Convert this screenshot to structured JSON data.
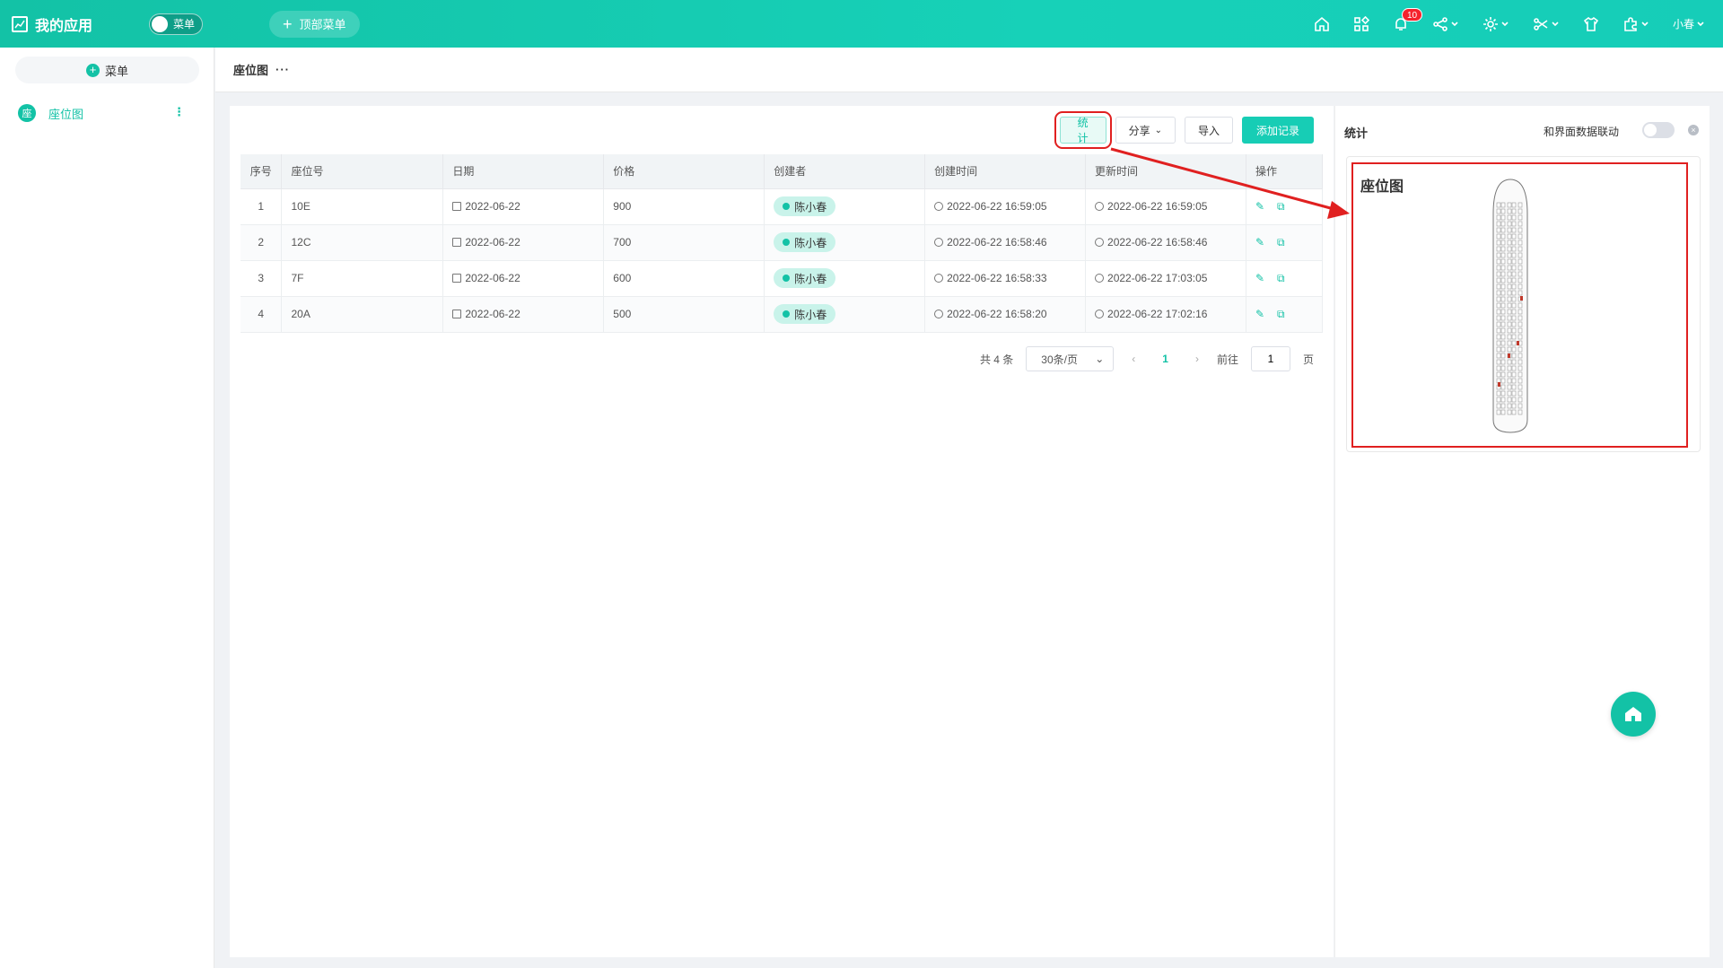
{
  "app": {
    "title": "我的应用"
  },
  "topbar": {
    "menu_toggle_label": "菜单",
    "top_menu_label": "顶部菜单",
    "notification_count": "10",
    "user_name": "小春"
  },
  "sidebar": {
    "add_menu_label": "菜单",
    "items": [
      {
        "icon_text": "座",
        "label": "座位图"
      }
    ]
  },
  "page": {
    "title": "座位图"
  },
  "toolbar": {
    "stat_label": "统计",
    "share_label": "分享",
    "import_label": "导入",
    "add_label": "添加记录"
  },
  "table": {
    "columns": [
      "序号",
      "座位号",
      "日期",
      "价格",
      "创建者",
      "创建时间",
      "更新时间",
      "操作"
    ],
    "rows": [
      {
        "seq": "1",
        "seat": "10E",
        "date": "2022-06-22",
        "price": "900",
        "creator": "陈小春",
        "created": "2022-06-22 16:59:05",
        "updated": "2022-06-22 16:59:05"
      },
      {
        "seq": "2",
        "seat": "12C",
        "date": "2022-06-22",
        "price": "700",
        "creator": "陈小春",
        "created": "2022-06-22 16:58:46",
        "updated": "2022-06-22 16:58:46"
      },
      {
        "seq": "3",
        "seat": "7F",
        "date": "2022-06-22",
        "price": "600",
        "creator": "陈小春",
        "created": "2022-06-22 16:58:33",
        "updated": "2022-06-22 17:03:05"
      },
      {
        "seq": "4",
        "seat": "20A",
        "date": "2022-06-22",
        "price": "500",
        "creator": "陈小春",
        "created": "2022-06-22 16:58:20",
        "updated": "2022-06-22 17:02:16"
      }
    ]
  },
  "pager": {
    "total": "共 4 条",
    "page_size": "30条/页",
    "current": "1",
    "goto_label": "前往",
    "goto_value": "1",
    "page_suffix": "页"
  },
  "stats_panel": {
    "title": "统计",
    "link_label": "和界面数据联动",
    "card_title": "座位图"
  },
  "colors": {
    "accent": "#13c2a6",
    "highlight": "#e02020"
  }
}
